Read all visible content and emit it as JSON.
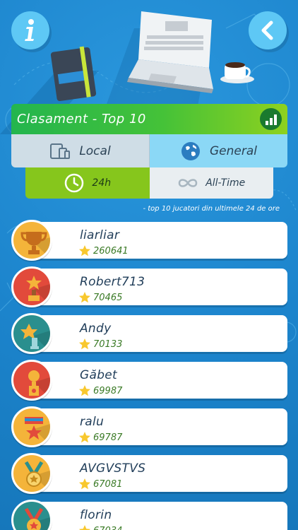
{
  "header": {
    "title": "Clasament - Top 10"
  },
  "scope_tabs": {
    "local": "Local",
    "general": "General"
  },
  "time_tabs": {
    "h24": "24h",
    "alltime": "All-Time"
  },
  "subtitle": "- top 10 jucatori din ultimele 24 de ore",
  "players": [
    {
      "name": "liarliar",
      "score": "260641",
      "medal_color": "#f4b43a"
    },
    {
      "name": "Robert713",
      "score": "70465",
      "medal_color": "#e24a3b"
    },
    {
      "name": "Andy",
      "score": "70133",
      "medal_color": "#2a8f8e"
    },
    {
      "name": "Găbet",
      "score": "69987",
      "medal_color": "#e24a3b"
    },
    {
      "name": "ralu",
      "score": "69787",
      "medal_color": "#f4b43a"
    },
    {
      "name": "AVGVSTVS",
      "score": "67081",
      "medal_color": "#f4b43a"
    },
    {
      "name": "florin",
      "score": "67034",
      "medal_color": "#2a8f8e"
    }
  ],
  "colors": {
    "background": "#1e88d0",
    "accent_green": "#45c238",
    "accent_light_blue": "#8bd8f6"
  }
}
